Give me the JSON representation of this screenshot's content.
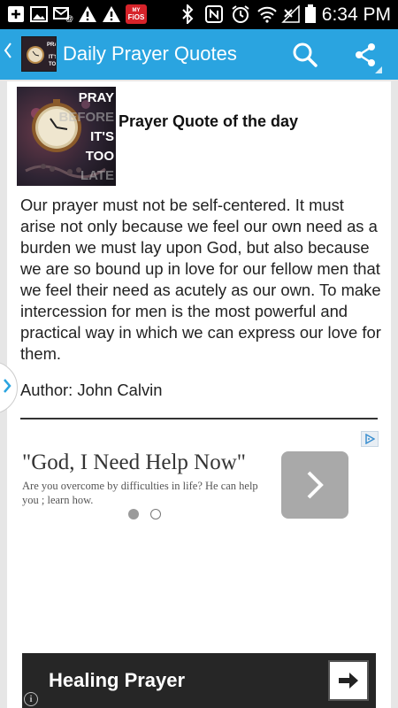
{
  "status_bar": {
    "time": "6:34 PM",
    "fios_label": "FiOS",
    "fios_top": "MY",
    "icons": [
      "plus-icon",
      "image-icon",
      "email-icon",
      "alert-icon",
      "alert-icon",
      "fios-app-icon",
      "bluetooth-icon",
      "nfc-icon",
      "alarm-icon",
      "wifi-icon",
      "no-signal-icon",
      "battery-icon"
    ]
  },
  "action_bar": {
    "title": "Daily Prayer Quotes",
    "icons": [
      "back-chevron-icon",
      "app-logo-icon",
      "search-icon",
      "share-icon"
    ],
    "accent": "#2aa4e0"
  },
  "content": {
    "image_words": [
      "PRAY",
      "BEFORE",
      "IT'S",
      "TOO",
      "LATE"
    ],
    "card_title": "Prayer Quote of the day",
    "quote": "Our prayer must not be self-centered. It must arise not only because we feel our own need as a burden we must lay upon God, but also because we are so bound up in love for our fellow men that we feel their need as acutely as our own. To make intercession for men is the most powerful and practical way in which we can express our love for them.",
    "author": "Author: John Calvin"
  },
  "ad": {
    "headline": "\"God, I Need Help Now\"",
    "body": "Are you overcome by difficulties in life? He can help you ; learn how.",
    "carousel_active_index": 0,
    "carousel_count": 2
  },
  "banner": {
    "label": "Healing Prayer"
  }
}
